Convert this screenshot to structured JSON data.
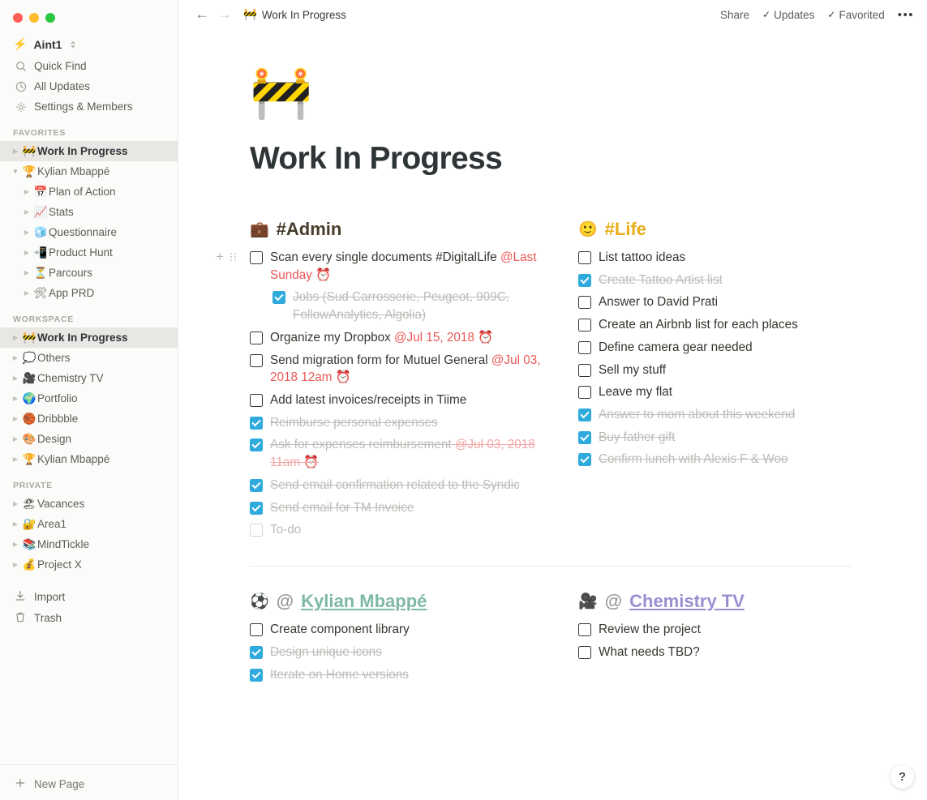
{
  "window": {
    "traffic_lights": [
      "close",
      "minimize",
      "zoom"
    ]
  },
  "sidebar": {
    "workspace": {
      "emoji": "⚡",
      "name": "Aint1"
    },
    "nav": [
      {
        "icon": "search-icon",
        "glyph": "⌕",
        "label": "Quick Find"
      },
      {
        "icon": "clock-icon",
        "glyph": "◷",
        "label": "All Updates"
      },
      {
        "icon": "gear-icon",
        "glyph": "✥",
        "label": "Settings & Members"
      }
    ],
    "sections": [
      {
        "label": "FAVORITES",
        "items": [
          {
            "emoji": "🚧",
            "label": "Work In Progress",
            "active": true,
            "expanded": false,
            "indent": 0
          },
          {
            "emoji": "🏆",
            "label": "Kylian Mbappé",
            "active": false,
            "expanded": true,
            "indent": 0
          },
          {
            "emoji": "📅",
            "label": "Plan of Action",
            "active": false,
            "expanded": false,
            "indent": 1
          },
          {
            "emoji": "📈",
            "label": "Stats",
            "active": false,
            "expanded": false,
            "indent": 1
          },
          {
            "emoji": "🧊",
            "label": "Questionnaire",
            "active": false,
            "expanded": false,
            "indent": 1
          },
          {
            "emoji": "📲",
            "label": "Product Hunt",
            "active": false,
            "expanded": false,
            "indent": 1
          },
          {
            "emoji": "⏳",
            "label": "Parcours",
            "active": false,
            "expanded": false,
            "indent": 1
          },
          {
            "emoji": "🛠",
            "label": "App PRD",
            "active": false,
            "expanded": false,
            "indent": 1
          }
        ]
      },
      {
        "label": "WORKSPACE",
        "items": [
          {
            "emoji": "🚧",
            "label": "Work In Progress",
            "active": true,
            "expanded": false,
            "indent": 0
          },
          {
            "emoji": "💭",
            "label": "Others",
            "active": false,
            "expanded": false,
            "indent": 0
          },
          {
            "emoji": "🎥",
            "label": "Chemistry TV",
            "active": false,
            "expanded": false,
            "indent": 0
          },
          {
            "emoji": "🌍",
            "label": "Portfolio",
            "active": false,
            "expanded": false,
            "indent": 0
          },
          {
            "emoji": "🏀",
            "label": "Dribbble",
            "active": false,
            "expanded": false,
            "indent": 0
          },
          {
            "emoji": "🎨",
            "label": "Design",
            "active": false,
            "expanded": false,
            "indent": 0
          },
          {
            "emoji": "🏆",
            "label": "Kylian Mbappé",
            "active": false,
            "expanded": false,
            "indent": 0
          }
        ]
      },
      {
        "label": "PRIVATE",
        "items": [
          {
            "emoji": "🏖",
            "label": "Vacances",
            "active": false,
            "expanded": false,
            "indent": 0
          },
          {
            "emoji": "🔐",
            "label": "Area1",
            "active": false,
            "expanded": false,
            "indent": 0
          },
          {
            "emoji": "📚",
            "label": "MindTickle",
            "active": false,
            "expanded": false,
            "indent": 0
          },
          {
            "emoji": "💰",
            "label": "Project X",
            "active": false,
            "expanded": false,
            "indent": 0
          }
        ]
      }
    ],
    "bottom": [
      {
        "icon": "import-icon",
        "glyph": "⤓",
        "label": "Import"
      },
      {
        "icon": "trash-icon",
        "glyph": "🗑",
        "label": "Trash"
      }
    ],
    "footer": {
      "icon": "plus-icon",
      "glyph": "+",
      "label": "New Page"
    }
  },
  "topbar": {
    "back": "←",
    "forward": "→",
    "breadcrumb": {
      "emoji": "🚧",
      "label": "Work In Progress"
    },
    "share_label": "Share",
    "updates_label": "Updates",
    "favorited_label": "Favorited",
    "more_label": "•••"
  },
  "page": {
    "emoji": "🚧",
    "title": "Work In Progress"
  },
  "columns": [
    {
      "heading": {
        "emoji": "💼",
        "text": "#Admin",
        "style": "admin"
      },
      "items": [
        {
          "checked": false,
          "text": "Scan every single documents #DigitalLife ",
          "date": "@Last Sunday ⏰",
          "date_done": false,
          "sub": false,
          "hover": true
        },
        {
          "checked": true,
          "text": "Jobs (Sud Carrosserie, Peugeot, 909C, FollowAnalytics, Algolia)",
          "date": "",
          "date_done": false,
          "sub": true,
          "hover": false
        },
        {
          "checked": false,
          "text": "Organize my Dropbox ",
          "date": "@Jul 15, 2018 ⏰",
          "date_done": false,
          "sub": false,
          "hover": false
        },
        {
          "checked": false,
          "text": "Send migration form for Mutuel General ",
          "date": "@Jul 03, 2018 12am ⏰",
          "date_done": false,
          "sub": false,
          "hover": false
        },
        {
          "checked": false,
          "text": "Add latest invoices/receipts in Tiime",
          "date": "",
          "date_done": false,
          "sub": false,
          "hover": false
        },
        {
          "checked": true,
          "text": "Reimburse personal expenses",
          "date": "",
          "date_done": false,
          "sub": false,
          "hover": false
        },
        {
          "checked": true,
          "text": "Ask for expenses reimbursement ",
          "date": "@Jul 03, 2018 11am ⏰",
          "date_done": true,
          "sub": false,
          "hover": false
        },
        {
          "checked": true,
          "text": "Send email confirmation related to the Syndic",
          "date": "",
          "date_done": false,
          "sub": false,
          "hover": false
        },
        {
          "checked": true,
          "text": "Send email for TM Invoice",
          "date": "",
          "date_done": false,
          "sub": false,
          "hover": false
        },
        {
          "checked": false,
          "text": "To-do",
          "date": "",
          "date_done": false,
          "sub": false,
          "hover": false,
          "empty": true
        }
      ]
    },
    {
      "heading": {
        "emoji": "🙂",
        "text": "#Life",
        "style": "life"
      },
      "items": [
        {
          "checked": false,
          "text": "List tattoo ideas",
          "date": "",
          "date_done": false,
          "sub": false,
          "hover": false
        },
        {
          "checked": true,
          "text": "Create Tattoo Artist list",
          "date": "",
          "date_done": false,
          "sub": false,
          "hover": false
        },
        {
          "checked": false,
          "text": "Answer to David Prati",
          "date": "",
          "date_done": false,
          "sub": false,
          "hover": false
        },
        {
          "checked": false,
          "text": "Create an Airbnb list for each places",
          "date": "",
          "date_done": false,
          "sub": false,
          "hover": false
        },
        {
          "checked": false,
          "text": "Define camera gear needed",
          "date": "",
          "date_done": false,
          "sub": false,
          "hover": false
        },
        {
          "checked": false,
          "text": "Sell my stuff",
          "date": "",
          "date_done": false,
          "sub": false,
          "hover": false
        },
        {
          "checked": false,
          "text": "Leave my flat",
          "date": "",
          "date_done": false,
          "sub": false,
          "hover": false
        },
        {
          "checked": true,
          "text": "Answer to mom about this weekend",
          "date": "",
          "date_done": false,
          "sub": false,
          "hover": false
        },
        {
          "checked": true,
          "text": "Buy father gift",
          "date": "",
          "date_done": false,
          "sub": false,
          "hover": false
        },
        {
          "checked": true,
          "text": "Confirm lunch with Alexis F & Woo",
          "date": "",
          "date_done": false,
          "sub": false,
          "hover": false
        }
      ]
    },
    {
      "heading": {
        "emoji": "⚽",
        "at": "@",
        "text": "Kylian Mbappé",
        "style": "link-green"
      },
      "items": [
        {
          "checked": false,
          "text": "Create component library",
          "date": "",
          "date_done": false,
          "sub": false,
          "hover": false
        },
        {
          "checked": true,
          "text": "Design unique icons",
          "date": "",
          "date_done": false,
          "sub": false,
          "hover": false
        },
        {
          "checked": true,
          "text": "Iterate on Home versions",
          "date": "",
          "date_done": false,
          "sub": false,
          "hover": false
        }
      ]
    },
    {
      "heading": {
        "emoji": "🎥",
        "at": "@",
        "text": "Chemistry TV",
        "style": "link-purple"
      },
      "items": [
        {
          "checked": false,
          "text": "Review the project",
          "date": "",
          "date_done": false,
          "sub": false,
          "hover": false
        },
        {
          "checked": false,
          "text": "What needs TBD?",
          "date": "",
          "date_done": false,
          "sub": false,
          "hover": false
        }
      ]
    }
  ],
  "help": {
    "label": "?"
  },
  "colors": {
    "checkbox_checked": "#2eaadc",
    "date_red": "#eb5757",
    "life_heading": "#e9ad1a",
    "link_green": "#7eb9a4",
    "link_purple": "#9b8fd0",
    "sidebar_bg": "#fbfbfa"
  }
}
